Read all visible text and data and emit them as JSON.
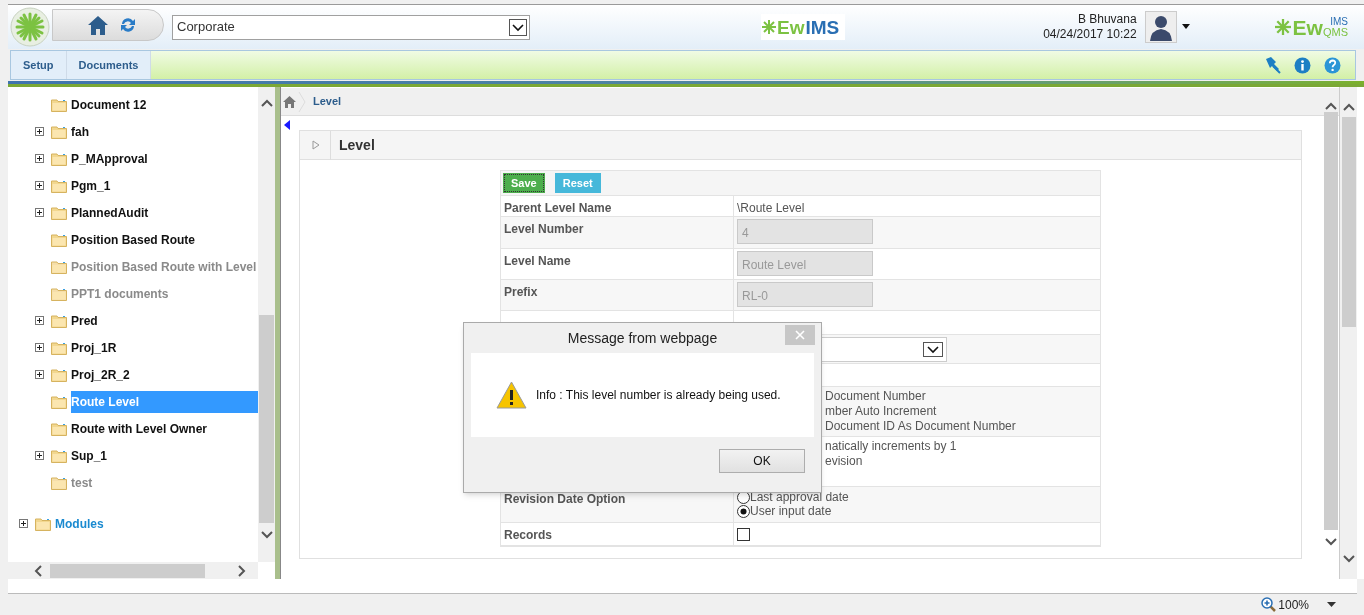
{
  "header": {
    "org_select": {
      "value": "Corporate"
    },
    "center_logo": {
      "part_1": "Ew",
      "part_2": "IMS"
    },
    "user": {
      "name": "B Bhuvana",
      "datetime": "04/24/2017 10:22"
    },
    "right_logo": {
      "part_1": "Ew",
      "part_2": "QMS",
      "part_3": "IMS"
    }
  },
  "menu": [
    {
      "label": "Setup"
    },
    {
      "label": "Documents"
    }
  ],
  "tree": {
    "items": [
      {
        "label": "Document 12",
        "expandable": false,
        "dimmed": false,
        "selected": false
      },
      {
        "label": "fah",
        "expandable": true,
        "dimmed": false,
        "selected": false
      },
      {
        "label": "P_MApproval",
        "expandable": true,
        "dimmed": false,
        "selected": false
      },
      {
        "label": "Pgm_1",
        "expandable": true,
        "dimmed": false,
        "selected": false
      },
      {
        "label": "PlannedAudit",
        "expandable": true,
        "dimmed": false,
        "selected": false
      },
      {
        "label": "Position Based Route",
        "expandable": false,
        "dimmed": false,
        "selected": false
      },
      {
        "label": "Position Based Route with Level",
        "expandable": false,
        "dimmed": true,
        "selected": false
      },
      {
        "label": "PPT1 documents",
        "expandable": false,
        "dimmed": true,
        "selected": false
      },
      {
        "label": "Pred",
        "expandable": true,
        "dimmed": false,
        "selected": false
      },
      {
        "label": "Proj_1R",
        "expandable": true,
        "dimmed": false,
        "selected": false
      },
      {
        "label": "Proj_2R_2",
        "expandable": true,
        "dimmed": false,
        "selected": false
      },
      {
        "label": "Route Level",
        "expandable": false,
        "dimmed": false,
        "selected": true
      },
      {
        "label": "Route with Level Owner",
        "expandable": false,
        "dimmed": false,
        "selected": false
      },
      {
        "label": "Sup_1",
        "expandable": true,
        "dimmed": false,
        "selected": false
      },
      {
        "label": "test",
        "expandable": false,
        "dimmed": true,
        "selected": false
      }
    ],
    "roots": [
      {
        "label": "Modules",
        "expandable": true
      }
    ]
  },
  "breadcrumb": "Level",
  "panel": {
    "title": "Level",
    "buttons": [
      {
        "label": "Save",
        "kind": "save"
      },
      {
        "label": "Reset",
        "kind": "reset"
      }
    ],
    "rows": [
      {
        "kind": "text",
        "label": "Parent Level Name",
        "value": "\\Route Level"
      },
      {
        "kind": "input",
        "label": "Level Number",
        "value": "4",
        "disabled": true
      },
      {
        "kind": "input",
        "label": "Level Name",
        "value": "Route Level",
        "disabled": true
      },
      {
        "kind": "input",
        "label": "Prefix",
        "value": "RL-0",
        "disabled": true
      },
      {
        "kind": "empty"
      },
      {
        "kind": "select"
      },
      {
        "kind": "empty"
      },
      {
        "kind": "lines",
        "lines": [
          "Document Number",
          "mber Auto Increment",
          "Document ID As Document Number"
        ]
      },
      {
        "kind": "lines",
        "lines": [
          "natically increments by 1",
          "evision"
        ]
      },
      {
        "kind": "radio",
        "label": "Revision Date Option",
        "options": [
          {
            "label": "Last approval date",
            "selected": false
          },
          {
            "label": "User input date",
            "selected": true
          }
        ]
      },
      {
        "kind": "checkbox",
        "label": "Records",
        "checked": false
      }
    ]
  },
  "dialog": {
    "title": "Message from webpage",
    "message": "Info : This level number is already being used.",
    "button": "OK"
  },
  "status_bar": {
    "zoom": "100%"
  }
}
